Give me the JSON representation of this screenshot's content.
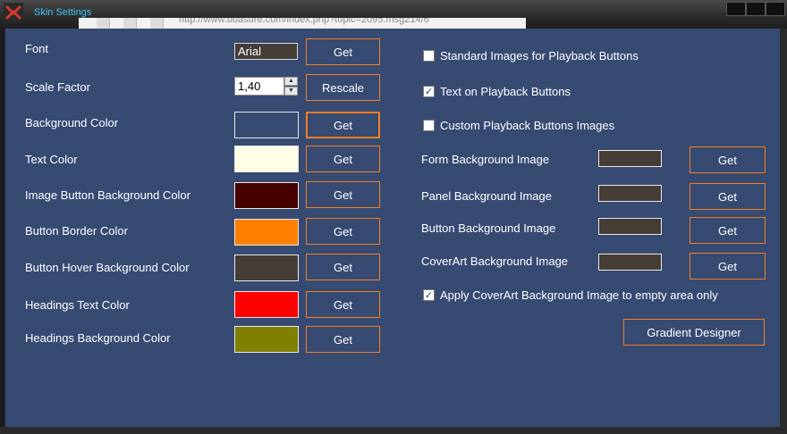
{
  "window": {
    "title": "Skin Settings",
    "background_url_text": "http://www.bbasure.com/index.php?topic=2095.msg214/6"
  },
  "left": {
    "rows": [
      {
        "label": "Font",
        "control": "textbox",
        "value": "Arial",
        "button": "Get"
      },
      {
        "label": "Scale Factor",
        "control": "spinbox",
        "value": "1,40",
        "button": "Rescale"
      },
      {
        "label": "Background Color",
        "control": "swatch",
        "color": "#374a72",
        "button": "Get"
      },
      {
        "label": "Text Color",
        "control": "swatch",
        "color": "#ffffe8",
        "button": "Get"
      },
      {
        "label": "Image Button Background Color",
        "control": "swatch",
        "color": "#460000",
        "button": "Get"
      },
      {
        "label": "Button Border Color",
        "control": "swatch",
        "color": "#ff8000",
        "button": "Get"
      },
      {
        "label": "Button Hover Background Color",
        "control": "swatch",
        "color": "#463d37",
        "button": "Get"
      },
      {
        "label": "Headings Text Color",
        "control": "swatch",
        "color": "#ff0000",
        "button": "Get"
      },
      {
        "label": "Headings Background Color",
        "control": "swatch",
        "color": "#808000",
        "button": "Get"
      }
    ]
  },
  "right": {
    "checkboxes": [
      {
        "label": "Standard Images for Playback Buttons",
        "checked": false
      },
      {
        "label": "Text on Playback Buttons",
        "checked": true
      },
      {
        "label": "Custom Playback Buttons Images",
        "checked": false
      }
    ],
    "image_rows": [
      {
        "label": "Form Background Image",
        "button": "Get"
      },
      {
        "label": "Panel Background Image",
        "button": "Get"
      },
      {
        "label": "Button Background Image",
        "button": "Get"
      },
      {
        "label": "CoverArt Background Image",
        "button": "Get"
      }
    ],
    "apply_checkbox": {
      "label": "Apply CoverArt Background Image to empty area only",
      "checked": true
    },
    "gradient_button": "Gradient Designer"
  },
  "colors": {
    "panel": "#374a72",
    "accent_border": "#f08024",
    "title_text": "#3fc6f4"
  }
}
